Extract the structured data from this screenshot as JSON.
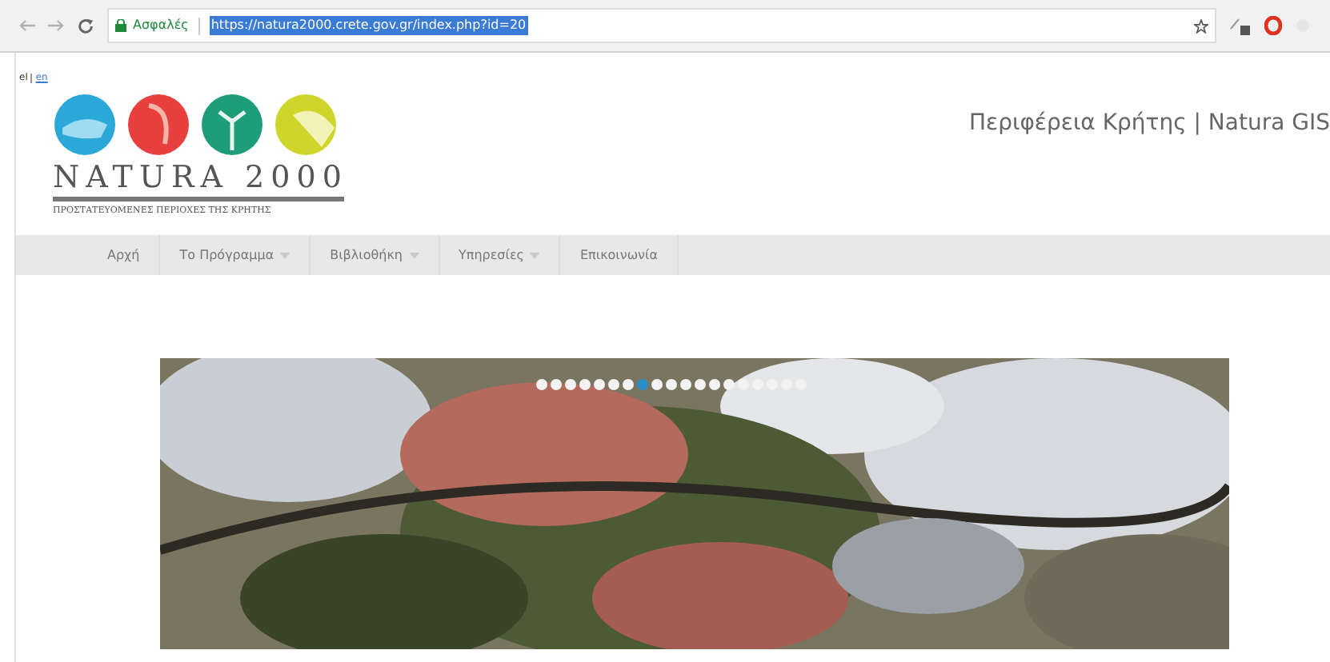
{
  "browser": {
    "security_label": "Ασφαλές",
    "url": "https://natura2000.crete.gov.gr/index.php?id=20"
  },
  "languages": [
    {
      "label": "el",
      "selected": true
    },
    {
      "label": "en",
      "selected": false
    }
  ],
  "logo": {
    "title": "NATURA 2000",
    "subtitle": "ΠΡΟΣΤΑΤΕΥΟΜΕΝΕΣ ΠΕΡΙΟΧΕΣ ΤΗΣ ΚΡΗΤΗΣ"
  },
  "site_title": "Περιφέρεια Κρήτης | Natura GIS",
  "nav": [
    {
      "label": "Αρχή",
      "has_dropdown": false
    },
    {
      "label": "Το Πρόγραμμα",
      "has_dropdown": true
    },
    {
      "label": "Βιβλιοθήκη",
      "has_dropdown": true
    },
    {
      "label": "Υπηρεσίες",
      "has_dropdown": true
    },
    {
      "label": "Επικοινωνία",
      "has_dropdown": false
    }
  ],
  "slider": {
    "dots": [
      {
        "selected": false
      },
      {
        "selected": false
      },
      {
        "selected": false
      },
      {
        "selected": false
      },
      {
        "selected": false
      },
      {
        "selected": false
      },
      {
        "selected": false
      },
      {
        "selected": true
      },
      {
        "selected": false
      },
      {
        "selected": false
      },
      {
        "selected": false
      },
      {
        "selected": false
      },
      {
        "selected": false
      },
      {
        "selected": false
      },
      {
        "selected": false
      },
      {
        "selected": false
      },
      {
        "selected": false
      },
      {
        "selected": false
      },
      {
        "selected": false
      }
    ]
  }
}
